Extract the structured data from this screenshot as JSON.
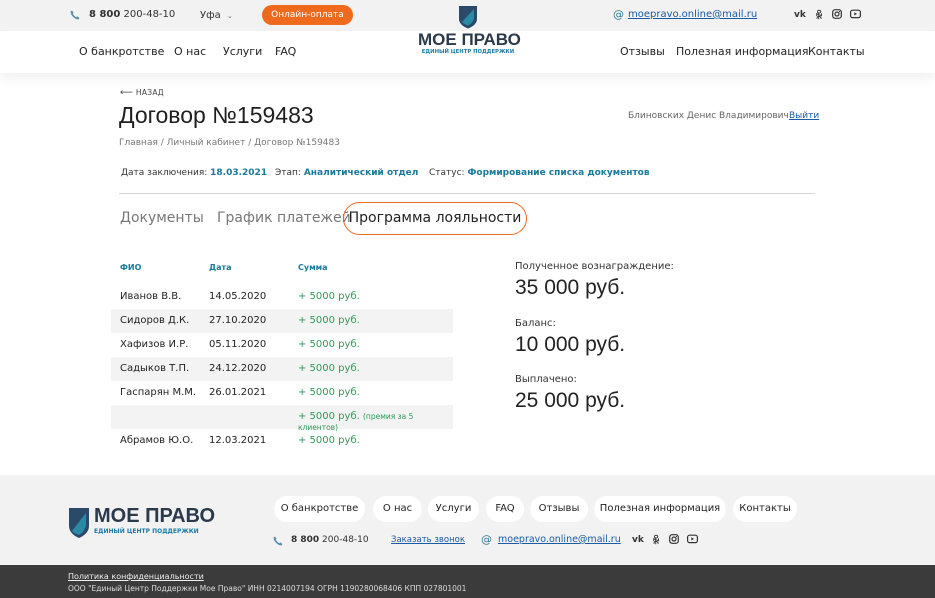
{
  "topbar": {
    "phone_bold": "8 800",
    "phone_rest": " 200-48-10",
    "city": "Уфа",
    "pay_button": "Онлайн-оплата",
    "email": "moepravo.online@mail.ru",
    "social": [
      "vk",
      "ok",
      "instagram",
      "youtube"
    ]
  },
  "logo": {
    "name": "МОЕ ПРАВО",
    "tagline": "ЕДИНЫЙ ЦЕНТР ПОДДЕРЖКИ"
  },
  "nav": {
    "left": [
      "О банкротстве",
      "О нас",
      "Услуги",
      "FAQ"
    ],
    "right": [
      "Отзывы",
      "Полезная информация",
      "Контакты"
    ]
  },
  "page": {
    "back": "НАЗАД",
    "title": "Договор №159483",
    "user_name": "Блиновских Денис Владимирович",
    "logout": "Выйти",
    "breadcrumbs": [
      "Главная",
      "Личный кабинет",
      "Договор №159483"
    ],
    "meta": {
      "date_label": "Дата заключения:",
      "date_value": "18.03.2021",
      "stage_label": "Этап:",
      "stage_value": "Аналитический отдел",
      "status_label": "Статус:",
      "status_value": "Формирование списка документов"
    },
    "tabs": [
      "Документы",
      "График платежей",
      "Программа лояльности"
    ],
    "active_tab": "Программа лояльности"
  },
  "table": {
    "headers": [
      "ФИО",
      "Дата",
      "Сумма"
    ],
    "rows": [
      {
        "name": "Иванов В.В.",
        "date": "14.05.2020",
        "sum": "+ 5000 руб.",
        "note": ""
      },
      {
        "name": "Сидоров Д.К.",
        "date": "27.10.2020",
        "sum": "+ 5000 руб.",
        "note": ""
      },
      {
        "name": "Хафизов И.Р.",
        "date": "05.11.2020",
        "sum": "+ 5000 руб.",
        "note": ""
      },
      {
        "name": "Садыков Т.П.",
        "date": "24.12.2020",
        "sum": "+ 5000 руб.",
        "note": ""
      },
      {
        "name": "Гаспарян М.М.",
        "date": "26.01.2021",
        "sum": "+ 5000 руб.",
        "note": ""
      },
      {
        "name": "",
        "date": "",
        "sum": "+ 5000 руб.",
        "note": "(премия за 5 клиентов)"
      },
      {
        "name": "Абрамов Ю.О.",
        "date": "12.03.2021",
        "sum": "+ 5000 руб.",
        "note": ""
      }
    ]
  },
  "stats": [
    {
      "label": "Полученное вознаграждение:",
      "value": "35 000 руб."
    },
    {
      "label": "Баланс:",
      "value": "10 000 руб."
    },
    {
      "label": "Выплачено:",
      "value": "25 000 руб."
    }
  ],
  "footer": {
    "nav": [
      "О банкротстве",
      "О нас",
      "Услуги",
      "FAQ",
      "Отзывы",
      "Полезная информация",
      "Контакты"
    ],
    "phone_bold": "8 800",
    "phone_rest": " 200-48-10",
    "callback": "Заказать звонок",
    "email": "moepravo.online@mail.ru",
    "policy": "Политика конфиденциальности",
    "legal": "ООО \"Единый Центр Поддержки Мое Право\" ИНН 0214007194 ОГРН 1190280068406 КПП 027801001"
  },
  "colors": {
    "accent": "#f06a1e",
    "teal": "#1a7a9a",
    "green": "#2e9a5a",
    "link": "#1a5aa6"
  }
}
